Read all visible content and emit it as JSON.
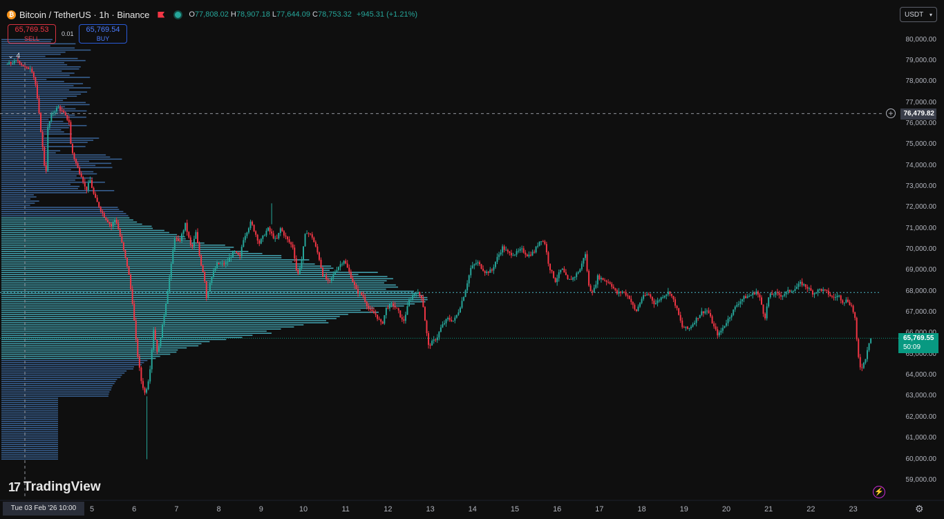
{
  "header": {
    "symbol": "Bitcoin / TetherUS · 1h · Binance",
    "open_label": "O",
    "open": "77,808.02",
    "high_label": "H",
    "high": "78,907.18",
    "low_label": "L",
    "low": "77,644.09",
    "close_label": "C",
    "close": "78,753.32",
    "change": "+945.31 (+1.21%)"
  },
  "trade": {
    "sell_price": "65,769.53",
    "sell_label": "SELL",
    "qty": "0.01",
    "buy_price": "65,769.54",
    "buy_label": "BUY"
  },
  "indicator_collapse": "4",
  "currency": "USDT",
  "logo": "TradingView",
  "crosshair_date": "Tue 03 Feb '26   10:00",
  "horizontal_line_price": "76,479.82",
  "current_price": "65,769.55",
  "countdown": "50:09",
  "colors": {
    "up": "#26a69a",
    "down": "#f23645",
    "volume_profile": "#4bb9c8",
    "background": "#0f0f0f"
  },
  "icons": [
    "bitcoin-icon",
    "flag-icon",
    "status-dot-icon",
    "chevron-down-icon",
    "plus-circle-icon",
    "lightning-icon",
    "gear-icon"
  ],
  "chart_data": {
    "type": "candlestick",
    "y_ticks": [
      "80,000.00",
      "79,000.00",
      "78,000.00",
      "77,000.00",
      "76,000.00",
      "75,000.00",
      "74,000.00",
      "73,000.00",
      "72,000.00",
      "71,000.00",
      "70,000.00",
      "69,000.00",
      "68,000.00",
      "67,000.00",
      "66,000.00",
      "65,000.00",
      "64,000.00",
      "63,000.00",
      "62,000.00",
      "61,000.00",
      "60,000.00",
      "59,000.00"
    ],
    "x_ticks": [
      "5",
      "6",
      "7",
      "8",
      "9",
      "10",
      "11",
      "12",
      "13",
      "14",
      "15",
      "16",
      "17",
      "18",
      "19",
      "20",
      "21",
      "22",
      "23"
    ],
    "ylim": [
      58600,
      80600
    ],
    "path": [
      [
        3.0,
        78800
      ],
      [
        3.3,
        79000
      ],
      [
        3.5,
        78600
      ],
      [
        3.6,
        78700
      ],
      [
        3.7,
        78000
      ],
      [
        3.8,
        76300
      ],
      [
        3.95,
        73400
      ],
      [
        4.0,
        75800
      ],
      [
        4.1,
        76500
      ],
      [
        4.25,
        76800
      ],
      [
        4.4,
        76400
      ],
      [
        4.5,
        76100
      ],
      [
        4.55,
        74800
      ],
      [
        4.7,
        73900
      ],
      [
        4.8,
        73500
      ],
      [
        4.9,
        72800
      ],
      [
        5.0,
        73300
      ],
      [
        5.1,
        72500
      ],
      [
        5.3,
        71700
      ],
      [
        5.5,
        71100
      ],
      [
        5.6,
        71500
      ],
      [
        5.75,
        70300
      ],
      [
        5.9,
        69000
      ],
      [
        6.0,
        67500
      ],
      [
        6.1,
        65300
      ],
      [
        6.2,
        63800
      ],
      [
        6.3,
        63100
      ],
      [
        6.4,
        64000
      ],
      [
        6.5,
        66200
      ],
      [
        6.6,
        65000
      ],
      [
        6.75,
        66900
      ],
      [
        6.9,
        69000
      ],
      [
        7.0,
        70600
      ],
      [
        7.1,
        70300
      ],
      [
        7.25,
        71200
      ],
      [
        7.4,
        70000
      ],
      [
        7.5,
        70800
      ],
      [
        7.6,
        69500
      ],
      [
        7.7,
        68700
      ],
      [
        7.75,
        67700
      ],
      [
        7.85,
        68600
      ],
      [
        8.0,
        69300
      ],
      [
        8.2,
        69300
      ],
      [
        8.4,
        69900
      ],
      [
        8.55,
        69600
      ],
      [
        8.6,
        70400
      ],
      [
        8.8,
        71300
      ],
      [
        8.9,
        70800
      ],
      [
        9.0,
        70300
      ],
      [
        9.2,
        71000
      ],
      [
        9.4,
        70400
      ],
      [
        9.5,
        71000
      ],
      [
        9.65,
        70500
      ],
      [
        9.8,
        70100
      ],
      [
        9.9,
        68700
      ],
      [
        10.0,
        69500
      ],
      [
        10.1,
        70900
      ],
      [
        10.25,
        70600
      ],
      [
        10.4,
        69700
      ],
      [
        10.5,
        68800
      ],
      [
        10.65,
        68400
      ],
      [
        10.8,
        69000
      ],
      [
        11.0,
        69500
      ],
      [
        11.15,
        68800
      ],
      [
        11.3,
        68000
      ],
      [
        11.45,
        67800
      ],
      [
        11.6,
        67100
      ],
      [
        11.75,
        66900
      ],
      [
        11.9,
        66400
      ],
      [
        12.0,
        67200
      ],
      [
        12.15,
        67400
      ],
      [
        12.3,
        67000
      ],
      [
        12.4,
        66500
      ],
      [
        12.55,
        67600
      ],
      [
        12.7,
        68000
      ],
      [
        12.85,
        67700
      ],
      [
        12.95,
        66100
      ],
      [
        13.0,
        65400
      ],
      [
        13.2,
        65800
      ],
      [
        13.3,
        66300
      ],
      [
        13.45,
        66700
      ],
      [
        13.6,
        66600
      ],
      [
        13.7,
        67000
      ],
      [
        13.85,
        67900
      ],
      [
        14.0,
        69100
      ],
      [
        14.15,
        69400
      ],
      [
        14.35,
        68900
      ],
      [
        14.5,
        69000
      ],
      [
        14.6,
        69500
      ],
      [
        14.75,
        70100
      ],
      [
        14.9,
        69800
      ],
      [
        15.05,
        69800
      ],
      [
        15.2,
        70000
      ],
      [
        15.35,
        69700
      ],
      [
        15.5,
        69900
      ],
      [
        15.65,
        70500
      ],
      [
        15.75,
        70300
      ],
      [
        15.85,
        69200
      ],
      [
        16.0,
        68500
      ],
      [
        16.15,
        69100
      ],
      [
        16.3,
        68500
      ],
      [
        16.45,
        68700
      ],
      [
        16.6,
        69100
      ],
      [
        16.7,
        69900
      ],
      [
        16.8,
        68100
      ],
      [
        16.9,
        68000
      ],
      [
        17.0,
        68700
      ],
      [
        17.1,
        68600
      ],
      [
        17.3,
        68400
      ],
      [
        17.45,
        67900
      ],
      [
        17.6,
        68000
      ],
      [
        17.75,
        67700
      ],
      [
        17.9,
        67000
      ],
      [
        18.05,
        67700
      ],
      [
        18.2,
        67900
      ],
      [
        18.35,
        67400
      ],
      [
        18.55,
        67800
      ],
      [
        18.7,
        68000
      ],
      [
        18.85,
        67300
      ],
      [
        19.0,
        66300
      ],
      [
        19.15,
        66200
      ],
      [
        19.3,
        66600
      ],
      [
        19.45,
        67000
      ],
      [
        19.6,
        67100
      ],
      [
        19.75,
        66300
      ],
      [
        19.85,
        65900
      ],
      [
        20.0,
        66400
      ],
      [
        20.15,
        66900
      ],
      [
        20.3,
        67400
      ],
      [
        20.45,
        67700
      ],
      [
        20.6,
        67800
      ],
      [
        20.75,
        68000
      ],
      [
        20.85,
        67600
      ],
      [
        20.95,
        66700
      ],
      [
        21.05,
        67800
      ],
      [
        21.2,
        67900
      ],
      [
        21.35,
        67800
      ],
      [
        21.5,
        68000
      ],
      [
        21.65,
        68100
      ],
      [
        21.8,
        68400
      ],
      [
        21.95,
        68200
      ],
      [
        22.1,
        67900
      ],
      [
        22.25,
        68100
      ],
      [
        22.4,
        68000
      ],
      [
        22.55,
        67700
      ],
      [
        22.7,
        67800
      ],
      [
        22.8,
        67500
      ],
      [
        22.9,
        67600
      ],
      [
        23.0,
        67300
      ],
      [
        23.08,
        66800
      ],
      [
        23.15,
        65000
      ],
      [
        23.22,
        64300
      ],
      [
        23.32,
        64700
      ],
      [
        23.4,
        65500
      ],
      [
        23.45,
        65770
      ]
    ],
    "volume_profile": {
      "levels_from": 60000,
      "level_step": 100,
      "levels_to": 80000,
      "note_peak_price": 67900
    }
  }
}
